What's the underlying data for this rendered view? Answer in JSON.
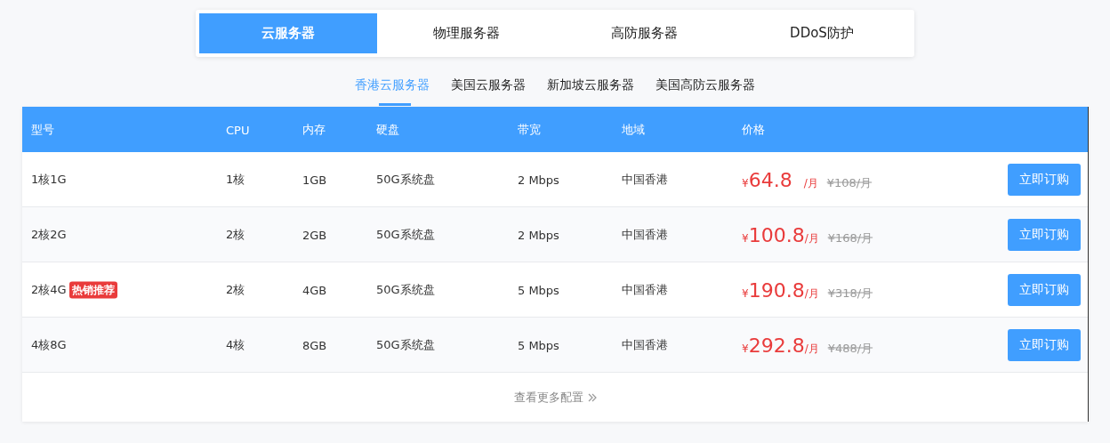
{
  "main_tabs": [
    {
      "label": "云服务器",
      "selected": true
    },
    {
      "label": "物理服务器",
      "selected": false
    },
    {
      "label": "高防服务器",
      "selected": false
    },
    {
      "label": "DDoS防护",
      "selected": false
    }
  ],
  "sub_tabs": [
    {
      "label": "香港云服务器",
      "selected": true
    },
    {
      "label": "美国云服务器",
      "selected": false
    },
    {
      "label": "新加坡云服务器",
      "selected": false
    },
    {
      "label": "美国高防云服务器",
      "selected": false
    }
  ],
  "table": {
    "columns": [
      "型号",
      "CPU",
      "内存",
      "硬盘",
      "带宽",
      "地域",
      "价格"
    ],
    "rows": [
      {
        "model": "1核1G",
        "cpu": "1核",
        "memory": "1GB",
        "disk": "50G系统盘",
        "bandwidth": "2 Mbps",
        "region": "中国香港",
        "currency": "¥",
        "price": "64.8",
        "unit": "/月",
        "old_price": "¥108/月",
        "action": "立即订购"
      },
      {
        "model": "2核2G",
        "cpu": "2核",
        "memory": "2GB",
        "disk": "50G系统盘",
        "bandwidth": "2 Mbps",
        "region": "中国香港",
        "currency": "¥",
        "price": "100.8",
        "unit": "/月",
        "old_price": "¥168/月",
        "action": "立即订购"
      },
      {
        "model": "2核4G",
        "badge": "热销推荐",
        "cpu": "2核",
        "memory": "4GB",
        "disk": "50G系统盘",
        "bandwidth": "5 Mbps",
        "region": "中国香港",
        "currency": "¥",
        "price": "190.8",
        "unit": "/月",
        "old_price": "¥318/月",
        "action": "立即订购"
      },
      {
        "model": "4核8G",
        "cpu": "4核",
        "memory": "8GB",
        "disk": "50G系统盘",
        "bandwidth": "5 Mbps",
        "region": "中国香港",
        "currency": "¥",
        "price": "292.8",
        "unit": "/月",
        "old_price": "¥488/月",
        "action": "立即订购"
      }
    ]
  },
  "more_link": "查看更多配置"
}
